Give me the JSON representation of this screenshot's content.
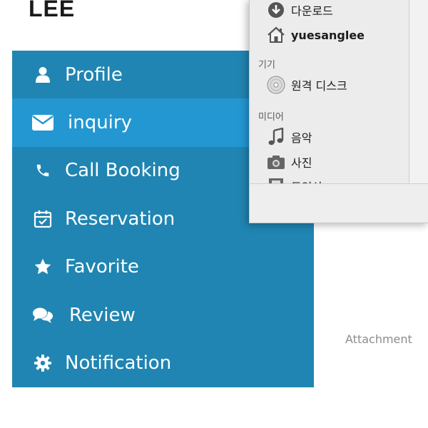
{
  "user": {
    "name": "LEE"
  },
  "sidebar": {
    "items": [
      {
        "label": "Profile",
        "icon": "user-icon"
      },
      {
        "label": "inquiry",
        "icon": "envelope-icon",
        "active": true
      },
      {
        "label": "Call Booking",
        "icon": "phone-icon"
      },
      {
        "label": "Reservation",
        "icon": "calendar-check-icon"
      },
      {
        "label": "Favorite",
        "icon": "star-icon"
      },
      {
        "label": "Review",
        "icon": "comments-icon"
      },
      {
        "label": "Notification",
        "icon": "gear-icon"
      }
    ]
  },
  "main": {
    "attachment_label": "Attachment"
  },
  "file_dialog": {
    "places": [
      {
        "label": "다운로드",
        "icon": "download-icon"
      },
      {
        "label": "yuesanglee",
        "icon": "home-icon"
      }
    ],
    "devices_header": "기기",
    "devices": [
      {
        "label": "원격 디스크",
        "icon": "disc-icon"
      }
    ],
    "media_header": "미디어",
    "media": [
      {
        "label": "음악",
        "icon": "music-icon"
      },
      {
        "label": "사진",
        "icon": "camera-icon"
      },
      {
        "label": "동영상",
        "icon": "film-icon"
      }
    ]
  },
  "colors": {
    "sidebar_bg": "#2085b2",
    "sidebar_active": "#2397d1",
    "text_on_sidebar": "#ffffff"
  }
}
